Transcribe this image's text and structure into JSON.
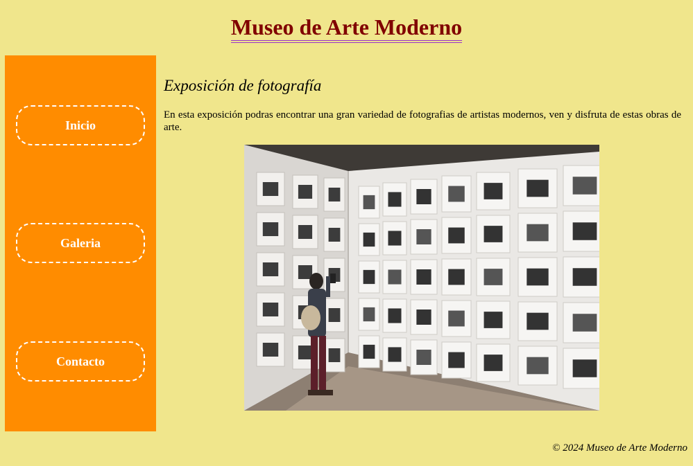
{
  "header": {
    "title": "Museo de Arte Moderno"
  },
  "sidebar": {
    "items": [
      {
        "label": "Inicio"
      },
      {
        "label": "Galeria"
      },
      {
        "label": "Contacto"
      }
    ]
  },
  "main": {
    "section_title": "Exposición de fotografía",
    "intro": "En esta exposición podras encontrar una gran variedad de fotografias de artistas modernos, ven y disfruta de estas obras de arte."
  },
  "footer": {
    "copyright": "© 2024 Museo de Arte Moderno"
  },
  "colors": {
    "background": "#f0e68c",
    "sidebar": "#ff8c00",
    "title": "#800000",
    "title_underline": "#9932cc",
    "nav_text": "#ffffff"
  }
}
